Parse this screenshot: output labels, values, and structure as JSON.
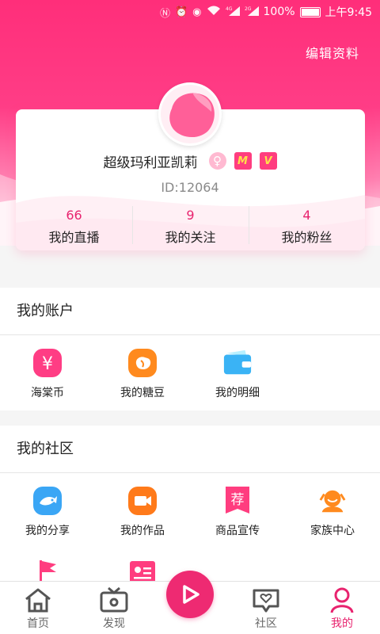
{
  "status_bar": {
    "battery": "100%",
    "time": "上午9:45",
    "net_4g": "4G",
    "net_2g": "2G"
  },
  "header": {
    "edit_profile": "编辑资料"
  },
  "profile": {
    "username": "超级玛利亚凯莉",
    "gender_icon": "female-icon",
    "gender_glyph": "♀",
    "badge_m": "M",
    "badge_v": "V",
    "user_id": "ID:12064",
    "stats": [
      {
        "value": "66",
        "label": "我的直播"
      },
      {
        "value": "9",
        "label": "我的关注"
      },
      {
        "value": "4",
        "label": "我的粉丝"
      }
    ]
  },
  "account": {
    "title": "我的账户",
    "items": [
      {
        "label": "海棠币",
        "icon": "yen-coin-icon"
      },
      {
        "label": "我的糖豆",
        "icon": "candy-bean-icon"
      },
      {
        "label": "我的明细",
        "icon": "wallet-icon"
      }
    ]
  },
  "community": {
    "title": "我的社区",
    "items": [
      {
        "label": "我的分享",
        "icon": "share-fish-icon"
      },
      {
        "label": "我的作品",
        "icon": "video-camera-icon"
      },
      {
        "label": "商品宣传",
        "icon": "recommend-tag-icon"
      },
      {
        "label": "家族中心",
        "icon": "family-icon"
      },
      {
        "label": "",
        "icon": "flag-icon"
      },
      {
        "label": "",
        "icon": "profile-card-icon"
      }
    ],
    "tag_glyph": "荐"
  },
  "bottom_nav": {
    "items": [
      {
        "label": "首页",
        "icon": "home-icon"
      },
      {
        "label": "发现",
        "icon": "tv-icon"
      },
      {
        "label": "",
        "icon": "live-play-icon"
      },
      {
        "label": "社区",
        "icon": "chat-heart-icon"
      },
      {
        "label": "我的",
        "icon": "person-icon"
      }
    ]
  },
  "colors": {
    "brand": "#ff2e7a",
    "accent": "#e8236e"
  }
}
